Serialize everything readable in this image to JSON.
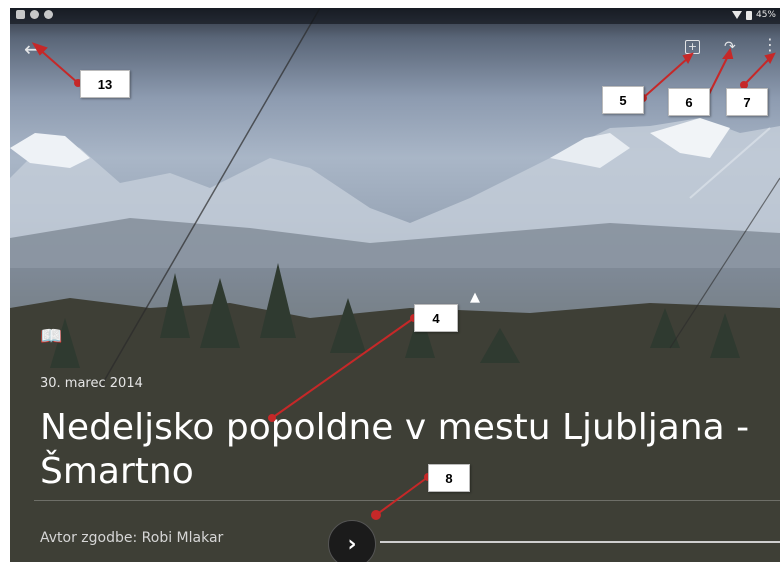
{
  "story": {
    "date": "30. marec 2014",
    "title_line1": "Nedeljsko popoldne v mestu Ljubljana -",
    "title_line2": "Šmartno",
    "author": "Avtor zgodbe: Robi Mlakar"
  },
  "statusbar": {
    "battery": "45%"
  },
  "icons": {
    "back": "back-arrow-icon",
    "add": "add-to-album-icon",
    "share": "share-icon",
    "more": "more-vertical-icon",
    "story": "book-icon",
    "next": "chevron-right-icon"
  },
  "callouts": {
    "c13": "13",
    "c5": "5",
    "c6": "6",
    "c7": "7",
    "c4": "4",
    "c8": "8"
  },
  "colors": {
    "annotation": "#c62828",
    "callout_bg": "#ffffff"
  }
}
